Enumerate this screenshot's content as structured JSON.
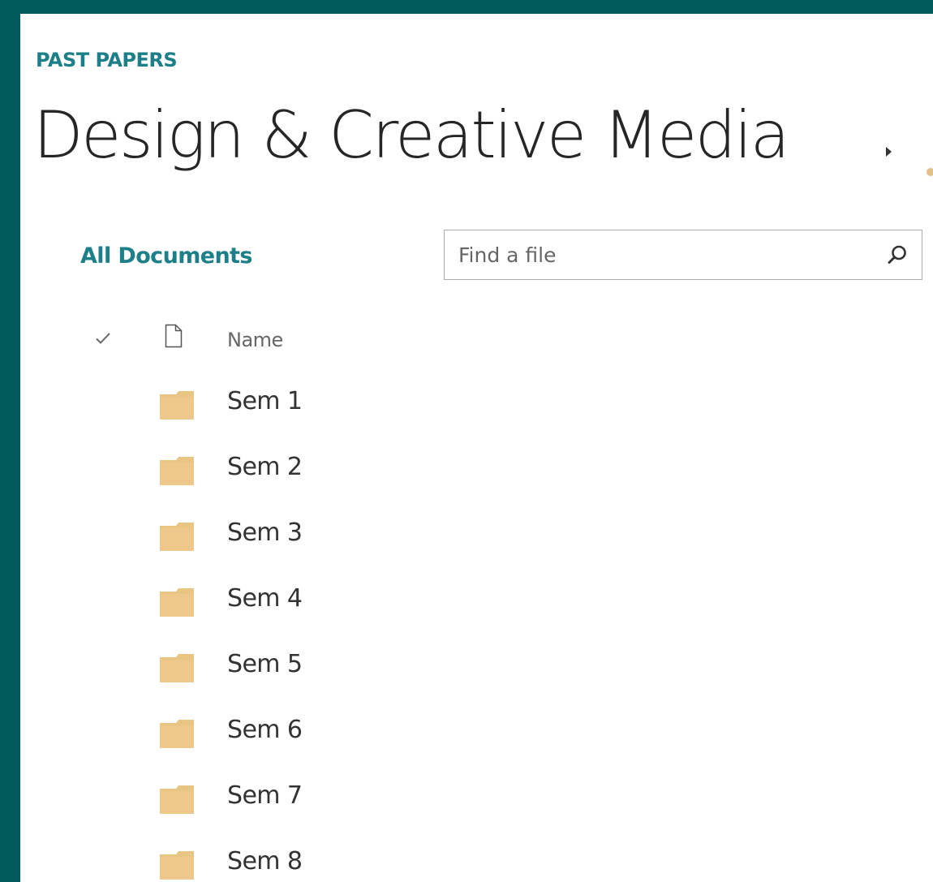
{
  "breadcrumb": {
    "parent": "PAST PAPERS"
  },
  "page": {
    "title": "Design & Creative Media"
  },
  "view": {
    "label": "All Documents"
  },
  "search": {
    "placeholder": "Find a file"
  },
  "list_header": {
    "name_column": "Name"
  },
  "items": [
    {
      "name": "Sem 1",
      "type": "folder"
    },
    {
      "name": "Sem 2",
      "type": "folder"
    },
    {
      "name": "Sem 3",
      "type": "folder"
    },
    {
      "name": "Sem 4",
      "type": "folder"
    },
    {
      "name": "Sem 5",
      "type": "folder"
    },
    {
      "name": "Sem 6",
      "type": "folder"
    },
    {
      "name": "Sem 7",
      "type": "folder"
    },
    {
      "name": "Sem 8",
      "type": "folder"
    }
  ],
  "colors": {
    "frame": "#005a5e",
    "accent": "#1d7f87",
    "folder": "#e9c584"
  },
  "icons": {
    "title_separator": "caret-right-icon",
    "search": "search-icon",
    "select_all": "check-icon",
    "file_type": "document-icon",
    "item": "folder-icon"
  }
}
